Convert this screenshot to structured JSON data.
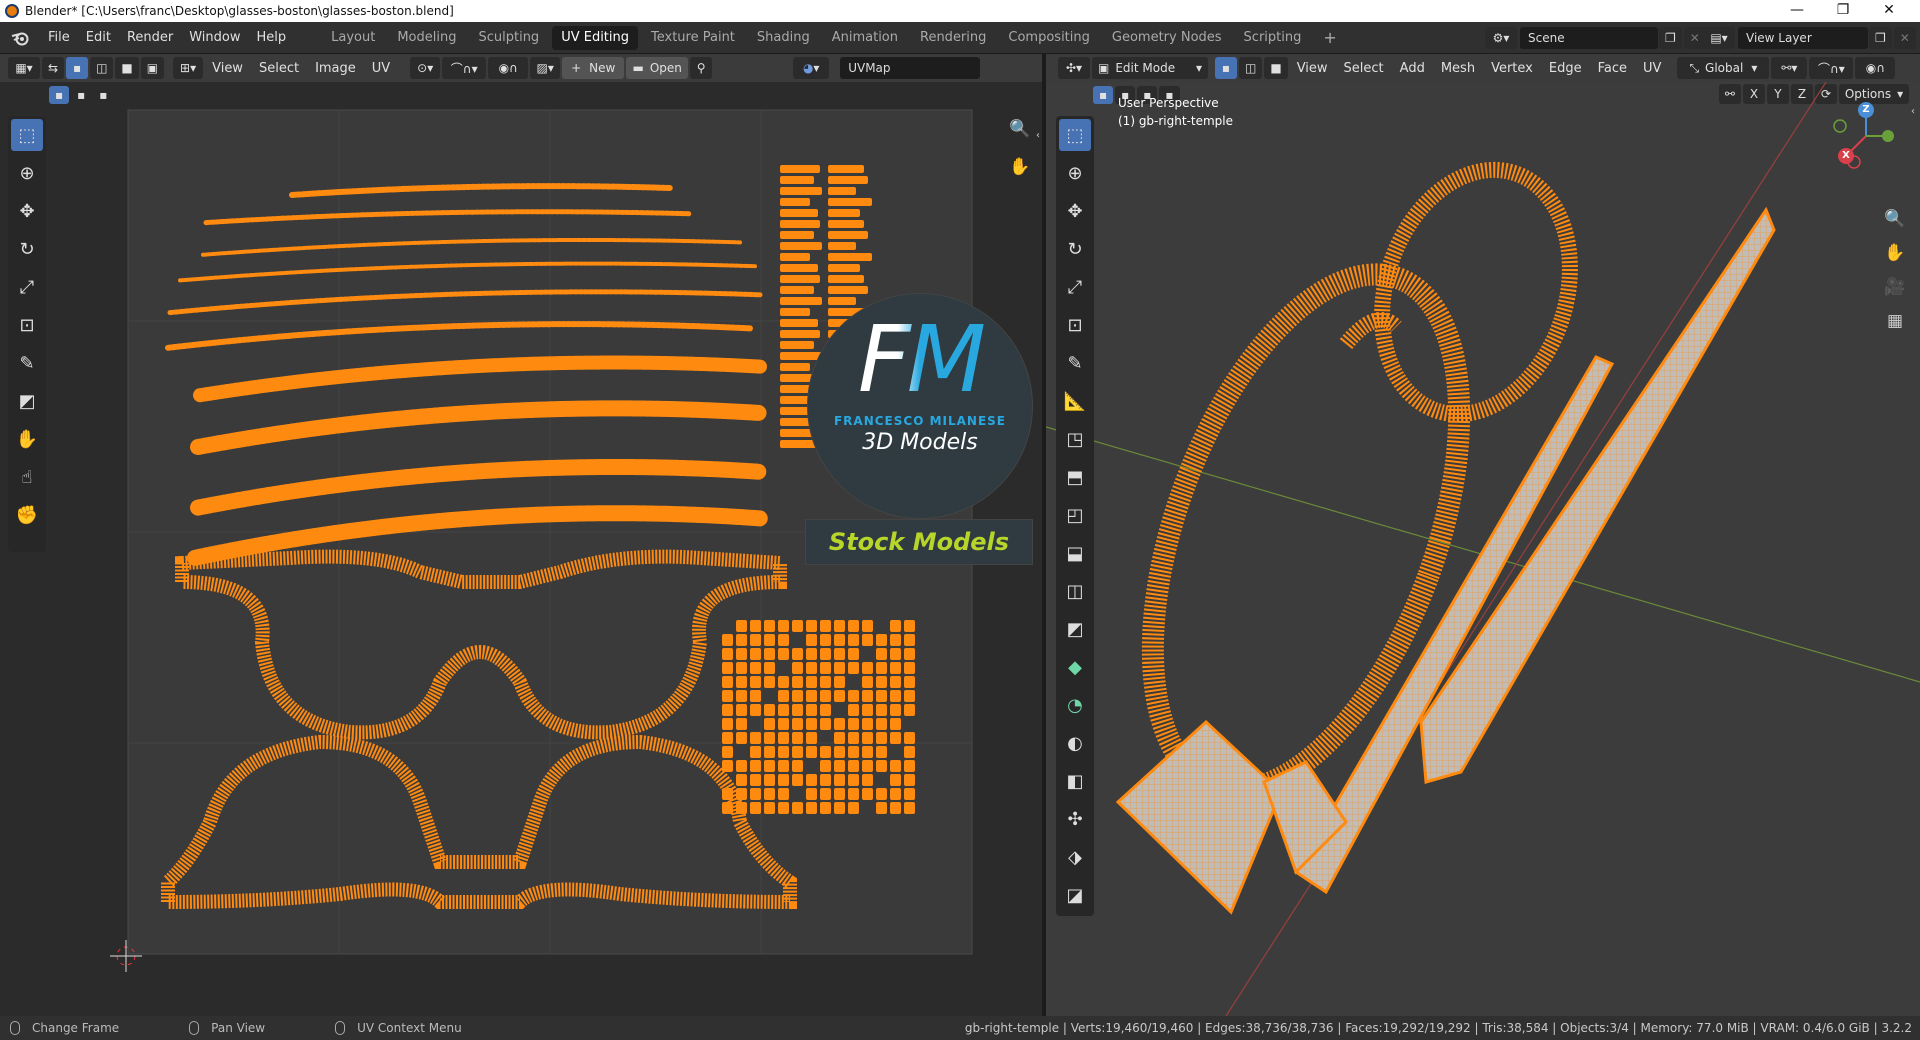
{
  "window": {
    "title": "Blender* [C:\\Users\\franc\\Desktop\\glasses-boston\\glasses-boston.blend]",
    "minimize": "—",
    "maximize": "❐",
    "close": "✕"
  },
  "menus": [
    "File",
    "Edit",
    "Render",
    "Window",
    "Help"
  ],
  "workspace_tabs": [
    "Layout",
    "Modeling",
    "Sculpting",
    "UV Editing",
    "Texture Paint",
    "Shading",
    "Animation",
    "Rendering",
    "Compositing",
    "Geometry Nodes",
    "Scripting"
  ],
  "active_tab": "UV Editing",
  "add_tab": "+",
  "scene": {
    "label": "Scene"
  },
  "view_layer": {
    "label": "View Layer"
  },
  "uv_editor": {
    "menus": [
      "View",
      "Select",
      "Image",
      "UV"
    ],
    "new_label": "New",
    "open_label": "Open",
    "uvmap": "UVMap"
  },
  "viewport": {
    "mode": "Edit Mode",
    "menus": [
      "View",
      "Select",
      "Add",
      "Mesh",
      "Vertex",
      "Edge",
      "Face",
      "UV"
    ],
    "orientation": "Global",
    "axis_x": "X",
    "axis_y": "Y",
    "axis_z": "Z",
    "options": "Options",
    "view_name": "User Perspective",
    "object_name": "(1) gb-right-temple",
    "gizmo": {
      "x": "X",
      "y": "Y",
      "z": "Z"
    }
  },
  "watermark": {
    "letters": "FM",
    "name": "FRANCESCO MILANESE",
    "sub": "3D Models",
    "banner": "Stock Models"
  },
  "colors": {
    "uv_orange": "#ff8a10",
    "accent_blue": "#4772b3",
    "banner_text": "#b8d62a"
  },
  "status": {
    "left": [
      {
        "icon": "mouse-left-icon",
        "label": "Change Frame"
      },
      {
        "icon": "mouse-middle-icon",
        "label": "Pan View"
      },
      {
        "icon": "mouse-right-icon",
        "label": "UV Context Menu"
      }
    ],
    "stats": "gb-right-temple | Verts:19,460/19,460 | Edges:38,736/38,736 | Faces:19,292/19,292 | Tris:38,584 | Objects:3/4 | Memory: 77.0 MiB | VRAM: 0.4/6.0 GiB | 3.2.2"
  }
}
